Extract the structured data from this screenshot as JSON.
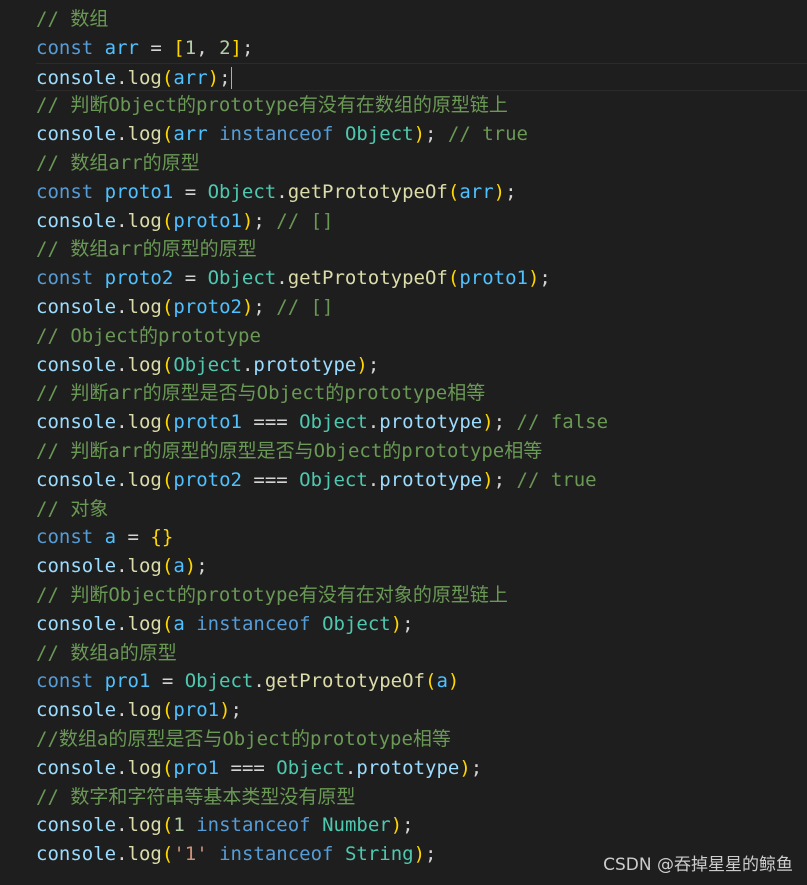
{
  "colors": {
    "background": "#1e1e1e",
    "comment": "#6a9955",
    "keyword": "#569cd6",
    "variable": "#9cdcfe",
    "function": "#dcdcaa",
    "constant": "#4fc1ff",
    "class": "#4ec9b0",
    "number": "#b5cea8",
    "string": "#ce9178",
    "punctuation": "#d4d4d4",
    "bracket_level1": "#ffd700",
    "bracket_level2": "#da70d6",
    "bracket_level3": "#179fff"
  },
  "code_lines": [
    {
      "tokens": [
        {
          "t": "// 数组",
          "c": "comment"
        }
      ]
    },
    {
      "tokens": [
        {
          "t": "const ",
          "c": "keyword"
        },
        {
          "t": "arr",
          "c": "const"
        },
        {
          "t": " = ",
          "c": "plain"
        },
        {
          "t": "[",
          "c": "bracket1"
        },
        {
          "t": "1",
          "c": "num"
        },
        {
          "t": ", ",
          "c": "plain"
        },
        {
          "t": "2",
          "c": "num"
        },
        {
          "t": "]",
          "c": "bracket1"
        },
        {
          "t": ";",
          "c": "plain"
        }
      ]
    },
    {
      "active": true,
      "tokens": [
        {
          "t": "console",
          "c": "var"
        },
        {
          "t": ".",
          "c": "plain"
        },
        {
          "t": "log",
          "c": "fn"
        },
        {
          "t": "(",
          "c": "bracket1"
        },
        {
          "t": "arr",
          "c": "const"
        },
        {
          "t": ")",
          "c": "bracket1"
        },
        {
          "t": ";",
          "c": "plain"
        }
      ]
    },
    {
      "tokens": [
        {
          "t": "// 判断Object的prototype有没有在数组的原型链上",
          "c": "comment"
        }
      ]
    },
    {
      "tokens": [
        {
          "t": "console",
          "c": "var"
        },
        {
          "t": ".",
          "c": "plain"
        },
        {
          "t": "log",
          "c": "fn"
        },
        {
          "t": "(",
          "c": "bracket1"
        },
        {
          "t": "arr",
          "c": "const"
        },
        {
          "t": " ",
          "c": "plain"
        },
        {
          "t": "instanceof",
          "c": "keyword"
        },
        {
          "t": " ",
          "c": "plain"
        },
        {
          "t": "Object",
          "c": "class"
        },
        {
          "t": ")",
          "c": "bracket1"
        },
        {
          "t": "; ",
          "c": "plain"
        },
        {
          "t": "// true",
          "c": "comment"
        }
      ]
    },
    {
      "tokens": [
        {
          "t": "// 数组arr的原型",
          "c": "comment"
        }
      ]
    },
    {
      "tokens": [
        {
          "t": "const ",
          "c": "keyword"
        },
        {
          "t": "proto1",
          "c": "const"
        },
        {
          "t": " = ",
          "c": "plain"
        },
        {
          "t": "Object",
          "c": "class"
        },
        {
          "t": ".",
          "c": "plain"
        },
        {
          "t": "getPrototypeOf",
          "c": "fn"
        },
        {
          "t": "(",
          "c": "bracket1"
        },
        {
          "t": "arr",
          "c": "const"
        },
        {
          "t": ")",
          "c": "bracket1"
        },
        {
          "t": ";",
          "c": "plain"
        }
      ]
    },
    {
      "tokens": [
        {
          "t": "console",
          "c": "var"
        },
        {
          "t": ".",
          "c": "plain"
        },
        {
          "t": "log",
          "c": "fn"
        },
        {
          "t": "(",
          "c": "bracket1"
        },
        {
          "t": "proto1",
          "c": "const"
        },
        {
          "t": ")",
          "c": "bracket1"
        },
        {
          "t": "; ",
          "c": "plain"
        },
        {
          "t": "// []",
          "c": "comment"
        }
      ]
    },
    {
      "tokens": [
        {
          "t": "// 数组arr的原型的原型",
          "c": "comment"
        }
      ]
    },
    {
      "tokens": [
        {
          "t": "const ",
          "c": "keyword"
        },
        {
          "t": "proto2",
          "c": "const"
        },
        {
          "t": " = ",
          "c": "plain"
        },
        {
          "t": "Object",
          "c": "class"
        },
        {
          "t": ".",
          "c": "plain"
        },
        {
          "t": "getPrototypeOf",
          "c": "fn"
        },
        {
          "t": "(",
          "c": "bracket1"
        },
        {
          "t": "proto1",
          "c": "const"
        },
        {
          "t": ")",
          "c": "bracket1"
        },
        {
          "t": ";",
          "c": "plain"
        }
      ]
    },
    {
      "tokens": [
        {
          "t": "console",
          "c": "var"
        },
        {
          "t": ".",
          "c": "plain"
        },
        {
          "t": "log",
          "c": "fn"
        },
        {
          "t": "(",
          "c": "bracket1"
        },
        {
          "t": "proto2",
          "c": "const"
        },
        {
          "t": ")",
          "c": "bracket1"
        },
        {
          "t": "; ",
          "c": "plain"
        },
        {
          "t": "// []",
          "c": "comment"
        }
      ]
    },
    {
      "tokens": [
        {
          "t": "// Object的prototype",
          "c": "comment"
        }
      ]
    },
    {
      "tokens": [
        {
          "t": "console",
          "c": "var"
        },
        {
          "t": ".",
          "c": "plain"
        },
        {
          "t": "log",
          "c": "fn"
        },
        {
          "t": "(",
          "c": "bracket1"
        },
        {
          "t": "Object",
          "c": "class"
        },
        {
          "t": ".",
          "c": "plain"
        },
        {
          "t": "prototype",
          "c": "var"
        },
        {
          "t": ")",
          "c": "bracket1"
        },
        {
          "t": ";",
          "c": "plain"
        }
      ]
    },
    {
      "tokens": [
        {
          "t": "// 判断arr的原型是否与Object的prototype相等",
          "c": "comment"
        }
      ]
    },
    {
      "tokens": [
        {
          "t": "console",
          "c": "var"
        },
        {
          "t": ".",
          "c": "plain"
        },
        {
          "t": "log",
          "c": "fn"
        },
        {
          "t": "(",
          "c": "bracket1"
        },
        {
          "t": "proto1",
          "c": "const"
        },
        {
          "t": " === ",
          "c": "plain"
        },
        {
          "t": "Object",
          "c": "class"
        },
        {
          "t": ".",
          "c": "plain"
        },
        {
          "t": "prototype",
          "c": "var"
        },
        {
          "t": ")",
          "c": "bracket1"
        },
        {
          "t": "; ",
          "c": "plain"
        },
        {
          "t": "// false",
          "c": "comment"
        }
      ]
    },
    {
      "tokens": [
        {
          "t": "// 判断arr的原型的原型是否与Object的prototype相等",
          "c": "comment"
        }
      ]
    },
    {
      "tokens": [
        {
          "t": "console",
          "c": "var"
        },
        {
          "t": ".",
          "c": "plain"
        },
        {
          "t": "log",
          "c": "fn"
        },
        {
          "t": "(",
          "c": "bracket1"
        },
        {
          "t": "proto2",
          "c": "const"
        },
        {
          "t": " === ",
          "c": "plain"
        },
        {
          "t": "Object",
          "c": "class"
        },
        {
          "t": ".",
          "c": "plain"
        },
        {
          "t": "prototype",
          "c": "var"
        },
        {
          "t": ")",
          "c": "bracket1"
        },
        {
          "t": "; ",
          "c": "plain"
        },
        {
          "t": "// true",
          "c": "comment"
        }
      ]
    },
    {
      "tokens": [
        {
          "t": "// 对象",
          "c": "comment"
        }
      ]
    },
    {
      "tokens": [
        {
          "t": "const ",
          "c": "keyword"
        },
        {
          "t": "a",
          "c": "const"
        },
        {
          "t": " = ",
          "c": "plain"
        },
        {
          "t": "{}",
          "c": "bracket1"
        }
      ]
    },
    {
      "tokens": [
        {
          "t": "console",
          "c": "var"
        },
        {
          "t": ".",
          "c": "plain"
        },
        {
          "t": "log",
          "c": "fn"
        },
        {
          "t": "(",
          "c": "bracket1"
        },
        {
          "t": "a",
          "c": "const"
        },
        {
          "t": ")",
          "c": "bracket1"
        },
        {
          "t": ";",
          "c": "plain"
        }
      ]
    },
    {
      "tokens": [
        {
          "t": "// 判断Object的prototype有没有在对象的原型链上",
          "c": "comment"
        }
      ]
    },
    {
      "tokens": [
        {
          "t": "console",
          "c": "var"
        },
        {
          "t": ".",
          "c": "plain"
        },
        {
          "t": "log",
          "c": "fn"
        },
        {
          "t": "(",
          "c": "bracket1"
        },
        {
          "t": "a",
          "c": "const"
        },
        {
          "t": " ",
          "c": "plain"
        },
        {
          "t": "instanceof",
          "c": "keyword"
        },
        {
          "t": " ",
          "c": "plain"
        },
        {
          "t": "Object",
          "c": "class"
        },
        {
          "t": ")",
          "c": "bracket1"
        },
        {
          "t": ";",
          "c": "plain"
        }
      ]
    },
    {
      "tokens": [
        {
          "t": "// 数组a的原型",
          "c": "comment"
        }
      ]
    },
    {
      "tokens": [
        {
          "t": "const ",
          "c": "keyword"
        },
        {
          "t": "pro1",
          "c": "const"
        },
        {
          "t": " = ",
          "c": "plain"
        },
        {
          "t": "Object",
          "c": "class"
        },
        {
          "t": ".",
          "c": "plain"
        },
        {
          "t": "getPrototypeOf",
          "c": "fn"
        },
        {
          "t": "(",
          "c": "bracket1"
        },
        {
          "t": "a",
          "c": "const"
        },
        {
          "t": ")",
          "c": "bracket1"
        }
      ]
    },
    {
      "tokens": [
        {
          "t": "console",
          "c": "var"
        },
        {
          "t": ".",
          "c": "plain"
        },
        {
          "t": "log",
          "c": "fn"
        },
        {
          "t": "(",
          "c": "bracket1"
        },
        {
          "t": "pro1",
          "c": "const"
        },
        {
          "t": ")",
          "c": "bracket1"
        },
        {
          "t": ";",
          "c": "plain"
        }
      ]
    },
    {
      "tokens": [
        {
          "t": "//数组a的原型是否与Object的prototype相等",
          "c": "comment"
        }
      ]
    },
    {
      "tokens": [
        {
          "t": "console",
          "c": "var"
        },
        {
          "t": ".",
          "c": "plain"
        },
        {
          "t": "log",
          "c": "fn"
        },
        {
          "t": "(",
          "c": "bracket1"
        },
        {
          "t": "pro1",
          "c": "const"
        },
        {
          "t": " === ",
          "c": "plain"
        },
        {
          "t": "Object",
          "c": "class"
        },
        {
          "t": ".",
          "c": "plain"
        },
        {
          "t": "prototype",
          "c": "var"
        },
        {
          "t": ")",
          "c": "bracket1"
        },
        {
          "t": ";",
          "c": "plain"
        }
      ]
    },
    {
      "tokens": [
        {
          "t": "// 数字和字符串等基本类型没有原型",
          "c": "comment"
        }
      ]
    },
    {
      "tokens": [
        {
          "t": "console",
          "c": "var"
        },
        {
          "t": ".",
          "c": "plain"
        },
        {
          "t": "log",
          "c": "fn"
        },
        {
          "t": "(",
          "c": "bracket1"
        },
        {
          "t": "1",
          "c": "num"
        },
        {
          "t": " ",
          "c": "plain"
        },
        {
          "t": "instanceof",
          "c": "keyword"
        },
        {
          "t": " ",
          "c": "plain"
        },
        {
          "t": "Number",
          "c": "class"
        },
        {
          "t": ")",
          "c": "bracket1"
        },
        {
          "t": ";",
          "c": "plain"
        }
      ]
    },
    {
      "tokens": [
        {
          "t": "console",
          "c": "var"
        },
        {
          "t": ".",
          "c": "plain"
        },
        {
          "t": "log",
          "c": "fn"
        },
        {
          "t": "(",
          "c": "bracket1"
        },
        {
          "t": "'1'",
          "c": "str"
        },
        {
          "t": " ",
          "c": "plain"
        },
        {
          "t": "instanceof",
          "c": "keyword"
        },
        {
          "t": " ",
          "c": "plain"
        },
        {
          "t": "String",
          "c": "class"
        },
        {
          "t": ")",
          "c": "bracket1"
        },
        {
          "t": ";",
          "c": "plain"
        }
      ]
    }
  ],
  "watermark": "CSDN @吞掉星星的鲸鱼"
}
